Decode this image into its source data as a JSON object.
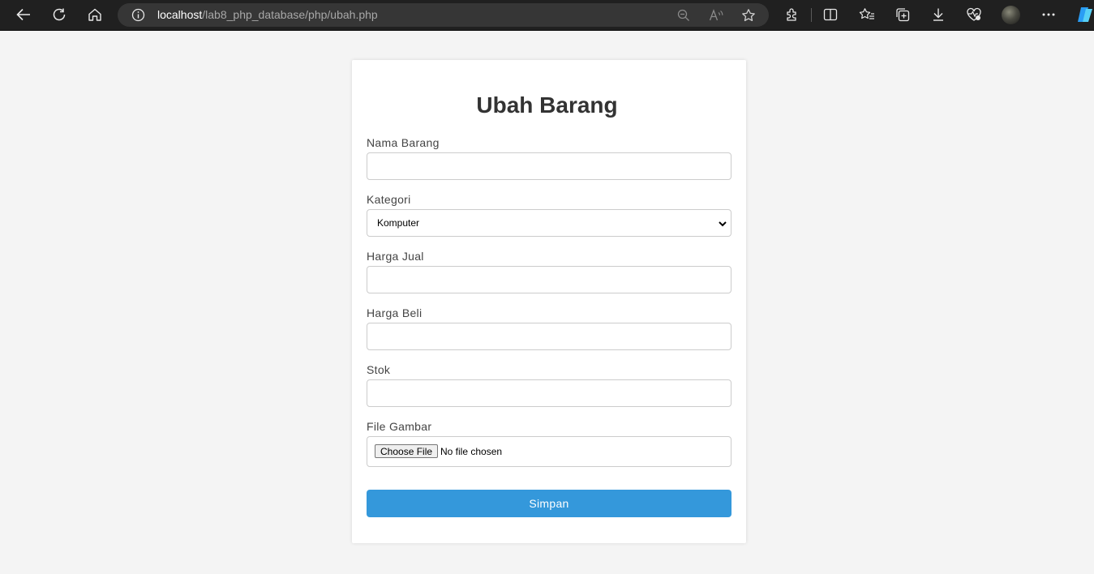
{
  "browser": {
    "url_host": "localhost",
    "url_path": "/lab8_php_database/php/ubah.php"
  },
  "form": {
    "title": "Ubah Barang",
    "fields": {
      "nama": {
        "label": "Nama Barang",
        "value": ""
      },
      "kategori": {
        "label": "Kategori",
        "selected": "Komputer"
      },
      "harga_jual": {
        "label": "Harga Jual",
        "value": ""
      },
      "harga_beli": {
        "label": "Harga Beli",
        "value": ""
      },
      "stok": {
        "label": "Stok",
        "value": ""
      },
      "gambar": {
        "label": "File Gambar",
        "button_label": "Choose File",
        "status": "No file chosen"
      }
    },
    "submit_label": "Simpan"
  },
  "colors": {
    "accent": "#3498db",
    "page_background": "#f4f4f4",
    "chrome_background": "#202020"
  }
}
